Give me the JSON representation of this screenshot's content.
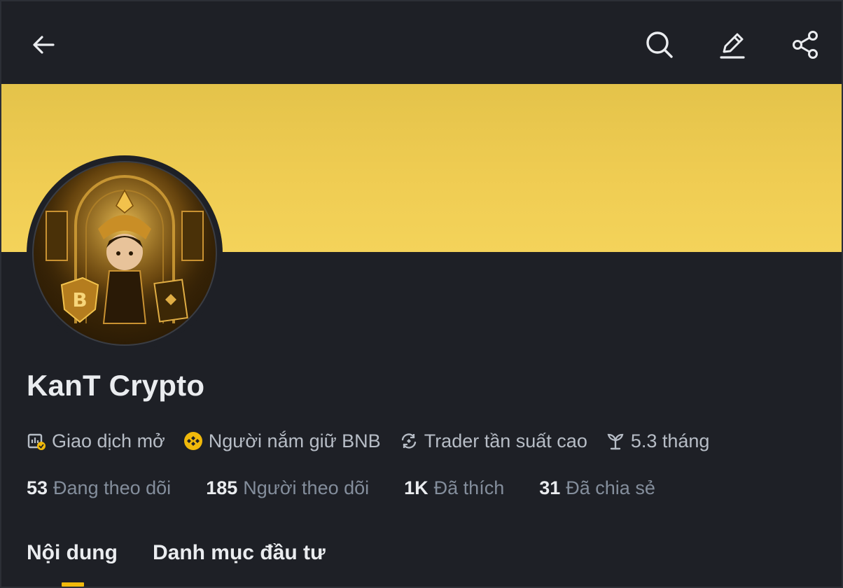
{
  "colors": {
    "background": "#1e2026",
    "banner": "#f0cd52",
    "accent": "#f0b90b",
    "primary_text": "#eaecef",
    "secondary_text": "#848e9c"
  },
  "toolbar": {
    "back_icon": "arrow-left-icon",
    "search_icon": "search-icon",
    "edit_icon": "pencil-icon",
    "share_icon": "share-icon"
  },
  "profile": {
    "name": "KanT Crypto",
    "avatar_icon": "avatar-golden-warrior"
  },
  "badges": [
    {
      "icon": "open-trading-icon",
      "label": "Giao dịch mở"
    },
    {
      "icon": "bnb-coin-icon",
      "label": "Người nắm giữ BNB"
    },
    {
      "icon": "refresh-cycle-icon",
      "label": "Trader tần suất cao"
    },
    {
      "icon": "sprout-icon",
      "label": "5.3 tháng"
    }
  ],
  "stats": [
    {
      "value": "53",
      "label": "Đang theo dõi"
    },
    {
      "value": "185",
      "label": "Người theo dõi"
    },
    {
      "value": "1K",
      "label": "Đã thích"
    },
    {
      "value": "31",
      "label": "Đã chia sẻ"
    }
  ],
  "tabs": [
    {
      "label": "Nội dung",
      "active": true
    },
    {
      "label": "Danh mục đầu tư",
      "active": false
    }
  ]
}
